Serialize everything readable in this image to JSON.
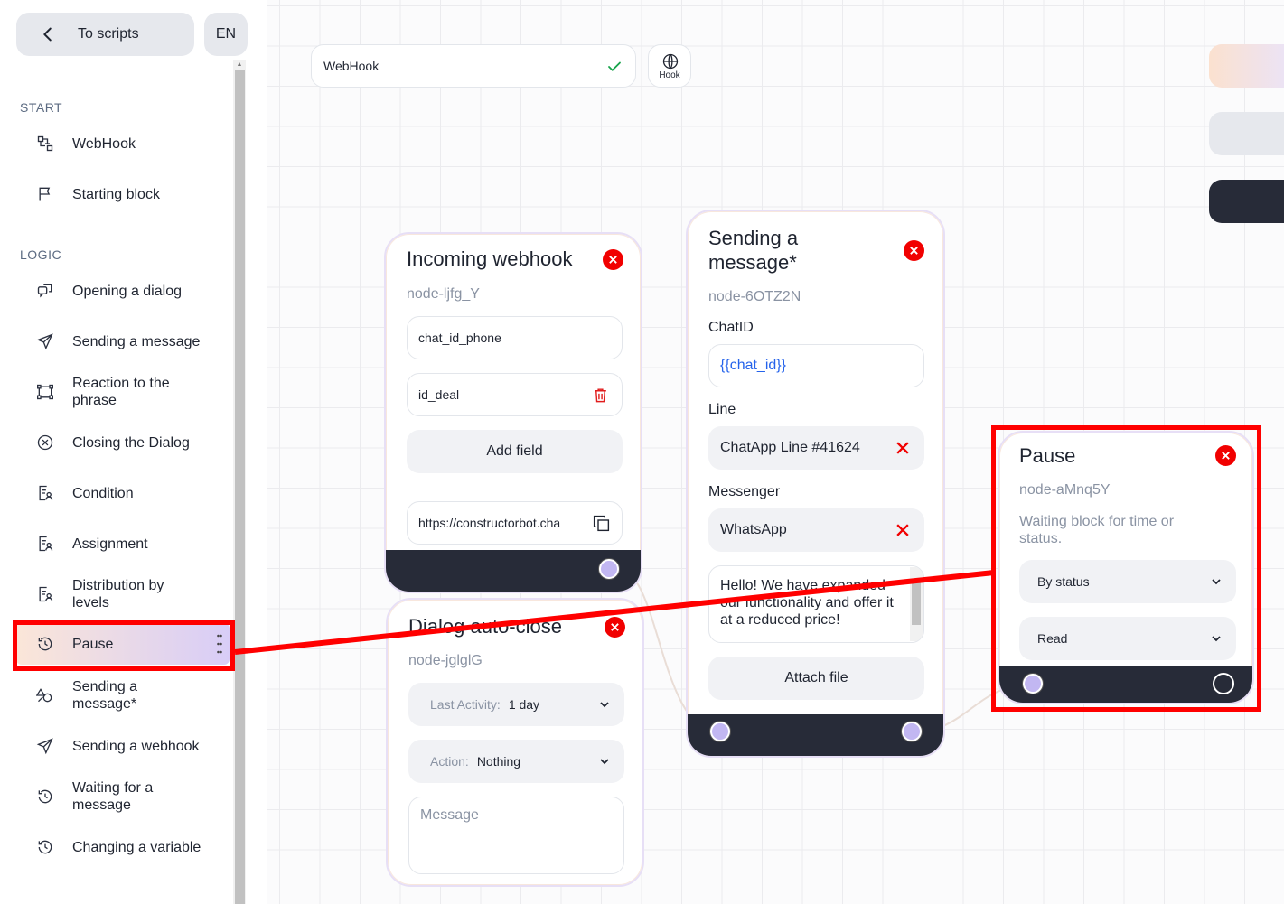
{
  "sidebar": {
    "back_label": "To scripts",
    "lang": "EN",
    "sections": {
      "start": "START",
      "logic": "LOGIC"
    },
    "items": {
      "webhook": "WebHook",
      "starting_block": "Starting block",
      "opening_dialog": "Opening a dialog",
      "sending_message": "Sending a message",
      "reaction_phrase": "Reaction to the phrase",
      "closing_dialog": "Closing the Dialog",
      "condition": "Condition",
      "assignment": "Assignment",
      "distribution_levels": "Distribution by levels",
      "pause": "Pause",
      "sending_message_star": "Sending a message*",
      "sending_webhook": "Sending a webhook",
      "waiting_message": "Waiting for a message",
      "changing_variable": "Changing a variable"
    }
  },
  "topbar": {
    "webhook_field": "WebHook",
    "hook_label": "Hook"
  },
  "nodes": {
    "incoming": {
      "title": "Incoming webhook",
      "id": "node-ljfg_Y",
      "field1": "chat_id_phone",
      "field2": "id_deal",
      "add_field": "Add field",
      "url": "https://constructorbot.cha"
    },
    "autoclose": {
      "title": "Dialog auto-close",
      "id": "node-jglglG",
      "last_activity_label": "Last Activity:",
      "last_activity_value": "1 day",
      "action_label": "Action:",
      "action_value": "Nothing",
      "message_placeholder": "Message"
    },
    "sending": {
      "title": "Sending a message*",
      "id": "node-6OTZ2N",
      "chatid_label": "ChatID",
      "chatid_value": "{{chat_id}}",
      "line_label": "Line",
      "line_value": "ChatApp Line #41624",
      "messenger_label": "Messenger",
      "messenger_value": "WhatsApp",
      "message_text": "Hello! We have expanded our functionality and offer it at a reduced price!",
      "attach": "Attach file"
    },
    "pause": {
      "title": "Pause",
      "id": "node-aMnq5Y",
      "description": "Waiting block for time or status.",
      "mode": "By status",
      "status": "Read"
    }
  },
  "colors": {
    "accent_red": "#f10000",
    "highlight": "#ff0000",
    "dark_bar": "#272b38",
    "port": "#c2b7f2"
  }
}
